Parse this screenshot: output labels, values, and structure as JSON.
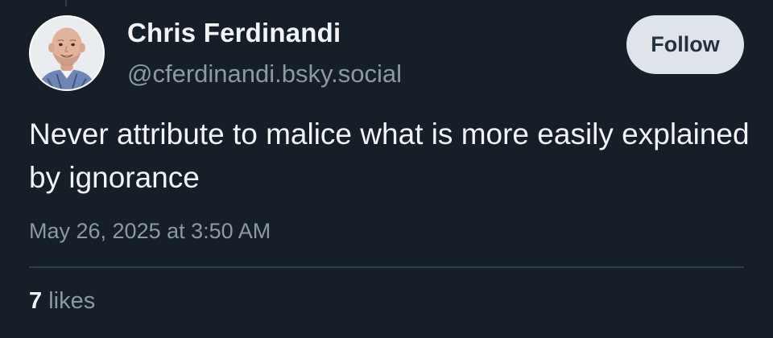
{
  "post": {
    "author": {
      "display_name": "Chris Ferdinandi",
      "handle": "@cferdinandi.bsky.social",
      "avatar_icon": "profile-photo"
    },
    "follow_label": "Follow",
    "text": "Never attribute to malice what is more easily explained by ignorance",
    "timestamp": "May 26, 2025 at 3:50 AM",
    "likes": {
      "count": "7",
      "label": "likes"
    }
  },
  "colors": {
    "background": "#161e27",
    "text_primary": "#f1f3f5",
    "text_secondary": "#8b98a8",
    "follow_button_bg": "#dfe4ea",
    "follow_button_text": "#24313f",
    "divider": "#2e3d4c"
  }
}
